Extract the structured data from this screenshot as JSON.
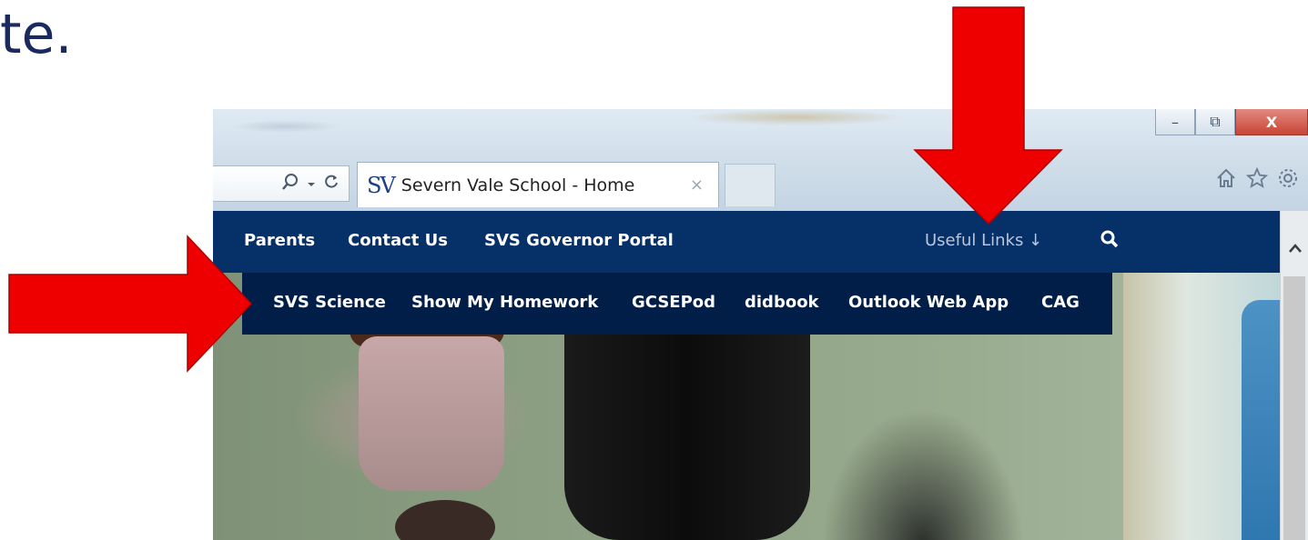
{
  "slide": {
    "text_fragment": "te."
  },
  "browser": {
    "tab_title": "Severn Vale School - Home",
    "tab_favicon_text": "SV",
    "tab_close_glyph": "×",
    "window_controls": {
      "minimize": "–",
      "restore": "⧉",
      "close": "X"
    },
    "toolbar_icons": [
      "home-icon",
      "favorites-star-icon",
      "settings-gear-icon"
    ],
    "address_icons": [
      "search-icon",
      "dropdown-icon",
      "refresh-icon"
    ]
  },
  "nav": {
    "items": [
      "Parents",
      "Contact Us",
      "SVS Governor Portal"
    ],
    "useful_links": "Useful Links ↓"
  },
  "dropdown": {
    "items": [
      "SVS Science",
      "Show My Homework",
      "GCSEPod",
      "didbook",
      "Outlook Web App",
      "CAG"
    ]
  },
  "colors": {
    "nav_bg": "#063068",
    "dropdown_bg": "#001e48",
    "arrow": "#ee0000",
    "slide_text": "#1b2a5e"
  }
}
